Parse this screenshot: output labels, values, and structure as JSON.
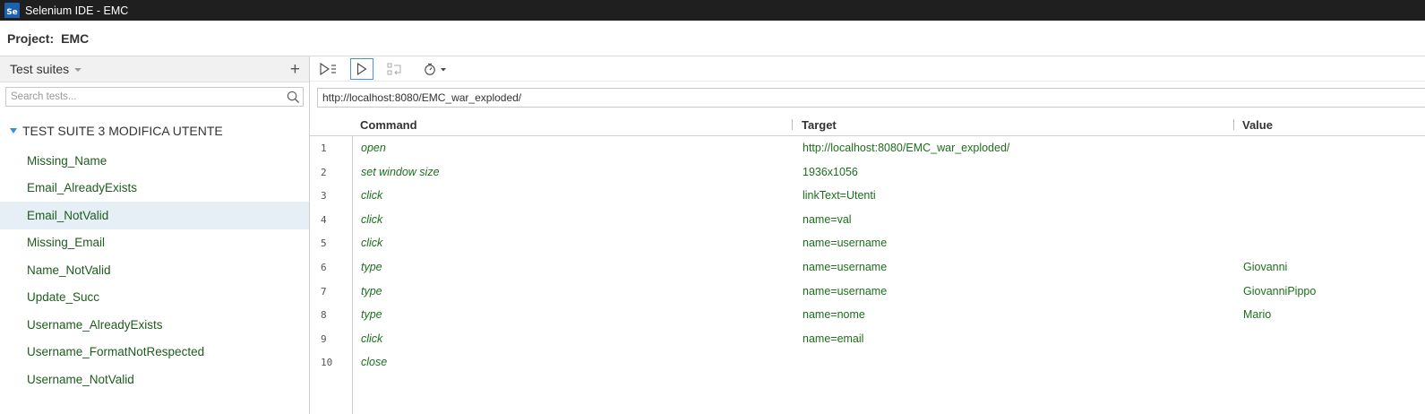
{
  "window": {
    "title": "Selenium IDE - EMC",
    "logo": "Se"
  },
  "project": {
    "label": "Project:",
    "name": "EMC"
  },
  "sidebar": {
    "header": "Test suites",
    "add_icon": "+",
    "search_placeholder": "Search tests...",
    "suite_name": "TEST SUITE 3 MODIFICA UTENTE",
    "tests": [
      "Missing_Name",
      "Email_AlreadyExists",
      "Email_NotValid",
      "Missing_Email",
      "Name_NotValid",
      "Update_Succ",
      "Username_AlreadyExists",
      "Username_FormatNotRespected",
      "Username_NotValid"
    ],
    "selected_test": "Email_NotValid"
  },
  "toolbar": {
    "icons": [
      "run-all-icon",
      "run-test-icon",
      "step-over-icon",
      "speed-timer-icon"
    ]
  },
  "url": {
    "value": "http://localhost:8080/EMC_war_exploded/"
  },
  "table": {
    "headers": {
      "command": "Command",
      "target": "Target",
      "value": "Value"
    },
    "rows": [
      {
        "num": "1",
        "command": "open",
        "target": "http://localhost:8080/EMC_war_exploded/",
        "value": ""
      },
      {
        "num": "2",
        "command": "set window size",
        "target": "1936x1056",
        "value": ""
      },
      {
        "num": "3",
        "command": "click",
        "target": "linkText=Utenti",
        "value": ""
      },
      {
        "num": "4",
        "command": "click",
        "target": "name=val",
        "value": ""
      },
      {
        "num": "5",
        "command": "click",
        "target": "name=username",
        "value": ""
      },
      {
        "num": "6",
        "command": "type",
        "target": "name=username",
        "value": "Giovanni"
      },
      {
        "num": "7",
        "command": "type",
        "target": "name=username",
        "value": "GiovanniPippo"
      },
      {
        "num": "8",
        "command": "type",
        "target": "name=nome",
        "value": "Mario"
      },
      {
        "num": "9",
        "command": "click",
        "target": "name=email",
        "value": ""
      },
      {
        "num": "10",
        "command": "close",
        "target": "",
        "value": ""
      }
    ]
  },
  "colors": {
    "command_text": "#1d6e1d",
    "selection": "#e6eef6",
    "accent": "#4a90e2"
  }
}
